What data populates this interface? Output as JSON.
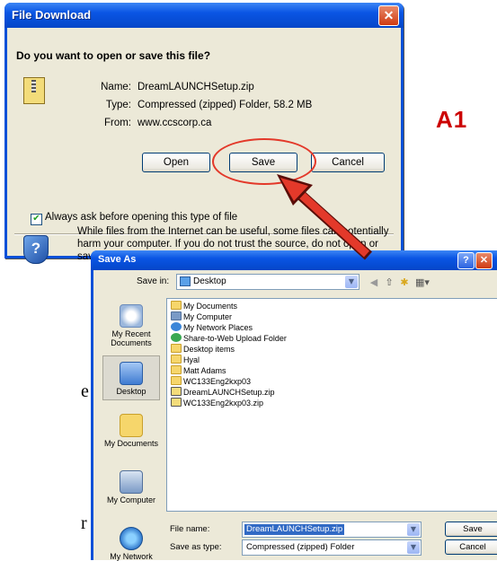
{
  "page": {
    "side_label": "A1",
    "fragment_e": "e",
    "fragment_r": "r"
  },
  "file_download": {
    "title": "File Download",
    "question": "Do you want to open or save this file?",
    "name_label": "Name:",
    "name_value": "DreamLAUNCHSetup.zip",
    "type_label": "Type:",
    "type_value": "Compressed (zipped) Folder, 58.2 MB",
    "from_label": "From:",
    "from_value": "www.ccscorp.ca",
    "open_label": "Open",
    "save_label": "Save",
    "cancel_label": "Cancel",
    "always_ask_label": "Always ask before opening this type of file",
    "always_ask_checked": true,
    "warning_lines": [
      "While files from the Internet can be useful, some files can potentially",
      "harm your computer. If you do not trust the source, do not open or",
      "save"
    ]
  },
  "save_as": {
    "title": "Save As",
    "save_in_label": "Save in:",
    "save_in_value": "Desktop",
    "places": [
      "My Recent Documents",
      "Desktop",
      "My Documents",
      "My Computer",
      "My Network"
    ],
    "files": [
      {
        "name": "My Documents",
        "icon": "folder-icon"
      },
      {
        "name": "My Computer",
        "icon": "computer-icon"
      },
      {
        "name": "My Network Places",
        "icon": "network-icon"
      },
      {
        "name": "Share-to-Web Upload Folder",
        "icon": "share-icon"
      },
      {
        "name": "Desktop items",
        "icon": "folder-icon"
      },
      {
        "name": "Hyal",
        "icon": "folder-icon"
      },
      {
        "name": "Matt Adams",
        "icon": "folder-icon"
      },
      {
        "name": "WC133Eng2kxp03",
        "icon": "folder-icon"
      },
      {
        "name": "DreamLAUNCHSetup.zip",
        "icon": "zip-icon"
      },
      {
        "name": "WC133Eng2kxp03.zip",
        "icon": "zip-icon"
      }
    ],
    "file_name_label": "File name:",
    "file_name_value": "DreamLAUNCHSetup.zip",
    "save_as_type_label": "Save as type:",
    "save_as_type_value": "Compressed (zipped) Folder",
    "save_label": "Save",
    "cancel_label": "Cancel"
  },
  "colors": {
    "title_blue": "#0a55e4",
    "highlight_red": "#e3392a",
    "close_red": "#cf3a12"
  }
}
